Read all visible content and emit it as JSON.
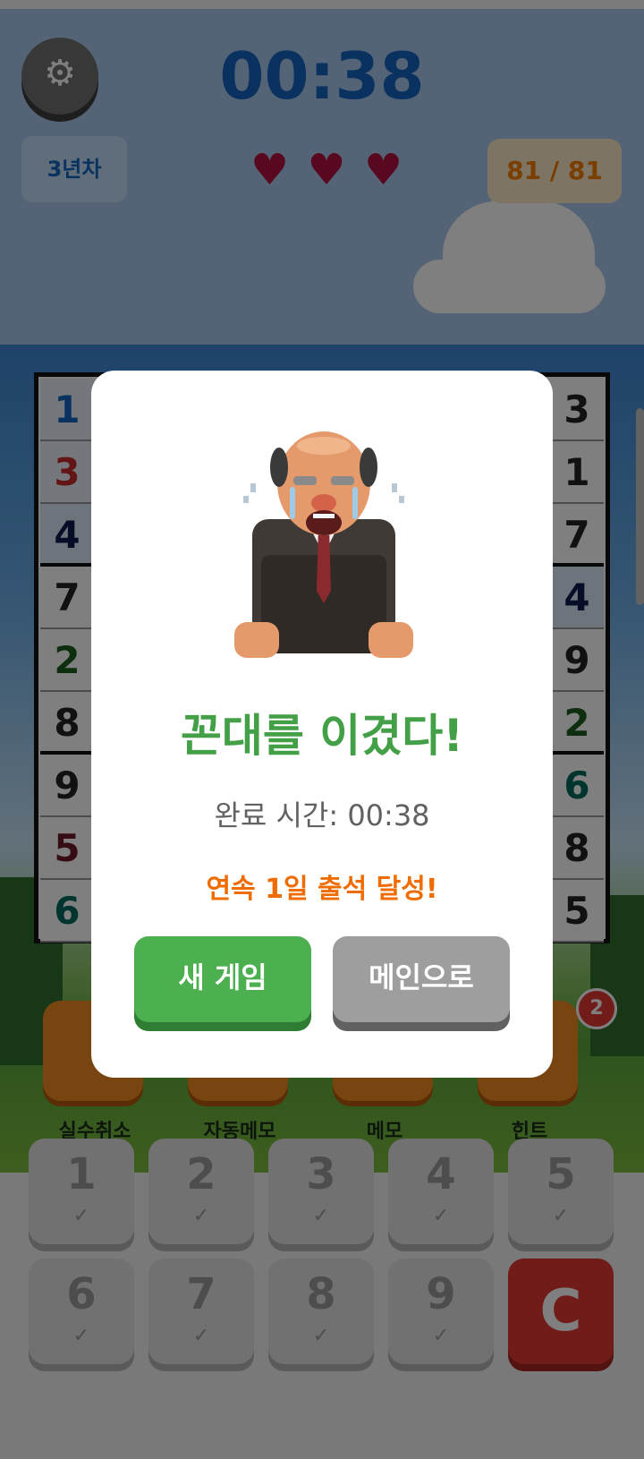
{
  "header": {
    "timer": "00:38",
    "level": "3년차",
    "progress": "81 / 81",
    "hearts": [
      "♥",
      "♥",
      "♥"
    ]
  },
  "board": {
    "left_column": [
      "1",
      "3",
      "4",
      "7",
      "2",
      "8",
      "9",
      "5",
      "6"
    ],
    "right_column": [
      "3",
      "1",
      "7",
      "4",
      "9",
      "2",
      "6",
      "8",
      "5"
    ]
  },
  "tools": {
    "undo": "실수취소",
    "auto_memo": "자동메모",
    "memo": "메모",
    "hint": "힌트",
    "hint_count": "2"
  },
  "keypad": {
    "keys": [
      "1",
      "2",
      "3",
      "4",
      "5",
      "6",
      "7",
      "8",
      "9"
    ],
    "check": "✓",
    "clear": "C"
  },
  "modal": {
    "title": "꼰대를 이겼다!",
    "time": "완료 시간: 00:38",
    "streak": "연속 1일 출석 달성!",
    "new_game": "새 게임",
    "to_main": "메인으로"
  },
  "icons": {
    "settings": "gear-icon",
    "heart": "heart-icon"
  },
  "colors": {
    "timer": "#1565c0",
    "heart": "#b0103e",
    "progress": "#f57c00",
    "title": "#43a047",
    "streak": "#ef6c00",
    "clear": "#e53935"
  }
}
